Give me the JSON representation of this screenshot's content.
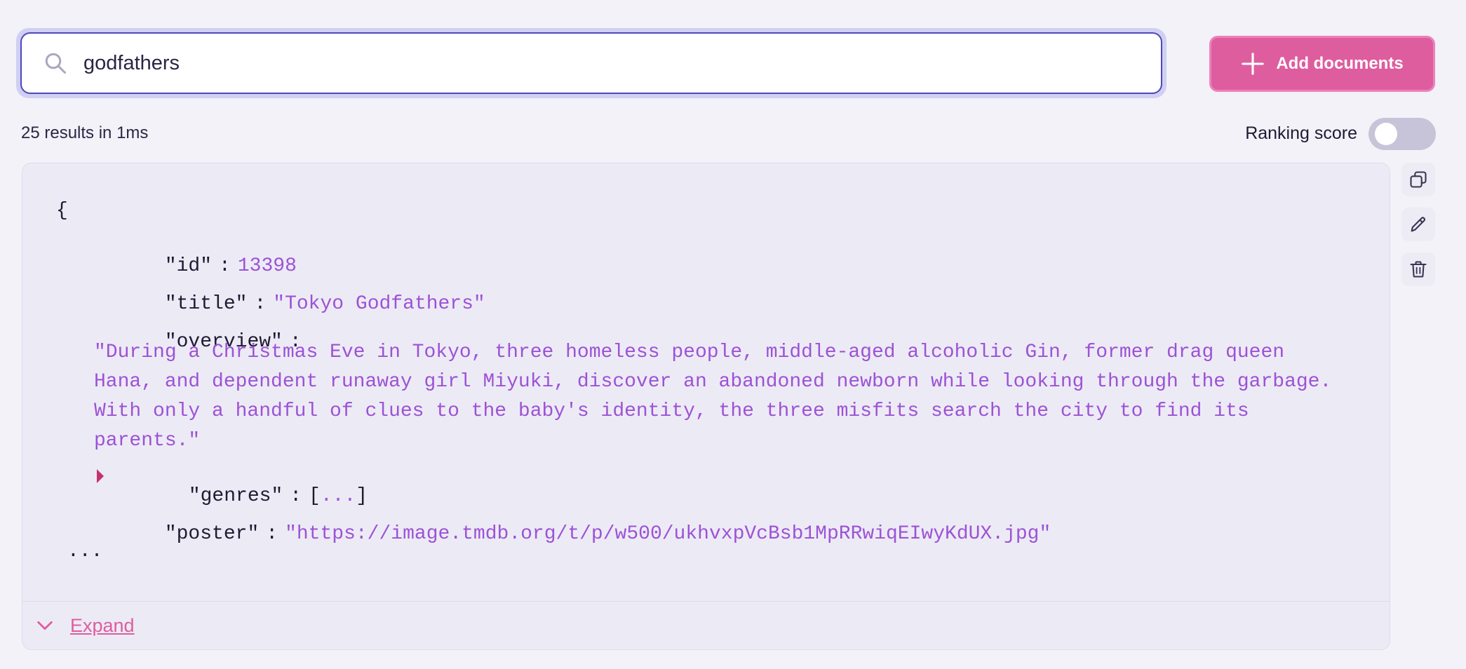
{
  "search": {
    "value": "godfathers",
    "placeholder": "Search"
  },
  "toolbar": {
    "add_label": "Add documents"
  },
  "results": {
    "summary": "25 results in 1ms",
    "ranking_label": "Ranking score",
    "ranking_enabled": false
  },
  "document": {
    "open_brace": "{",
    "fields": {
      "id": {
        "key": "\"id\"",
        "value": "13398"
      },
      "title": {
        "key": "\"title\"",
        "value": "\"Tokyo Godfathers\""
      },
      "overview": {
        "key": "\"overview\"",
        "lines": [
          "\"During a Christmas Eve in Tokyo, three homeless people, middle-aged alcoholic Gin, former drag queen",
          "Hana, and dependent runaway girl Miyuki, discover an abandoned newborn while looking through the garbage.",
          "With only a handful of clues to the baby's identity, the three misfits search the city to find its",
          "parents.\""
        ]
      },
      "genres": {
        "key": "\"genres\"",
        "open": "[",
        "collapsed": "...",
        "close": "]"
      },
      "poster": {
        "key": "\"poster\"",
        "value": "\"https://image.tmdb.org/t/p/w500/ukhvxpVcBsb1MpRRwiqEIwyKdUX.jpg\""
      }
    },
    "more": "...",
    "expand_label": "Expand"
  },
  "colors": {
    "accent": "#de5d9f",
    "value": "#9d52d6",
    "focus": "#4f48b9"
  },
  "icons": {
    "search": "search-icon",
    "add": "plus-icon",
    "copy": "copy-icon",
    "edit": "pencil-icon",
    "delete": "trash-icon",
    "collapse": "caret-right-icon",
    "expand": "chevron-down-icon"
  }
}
